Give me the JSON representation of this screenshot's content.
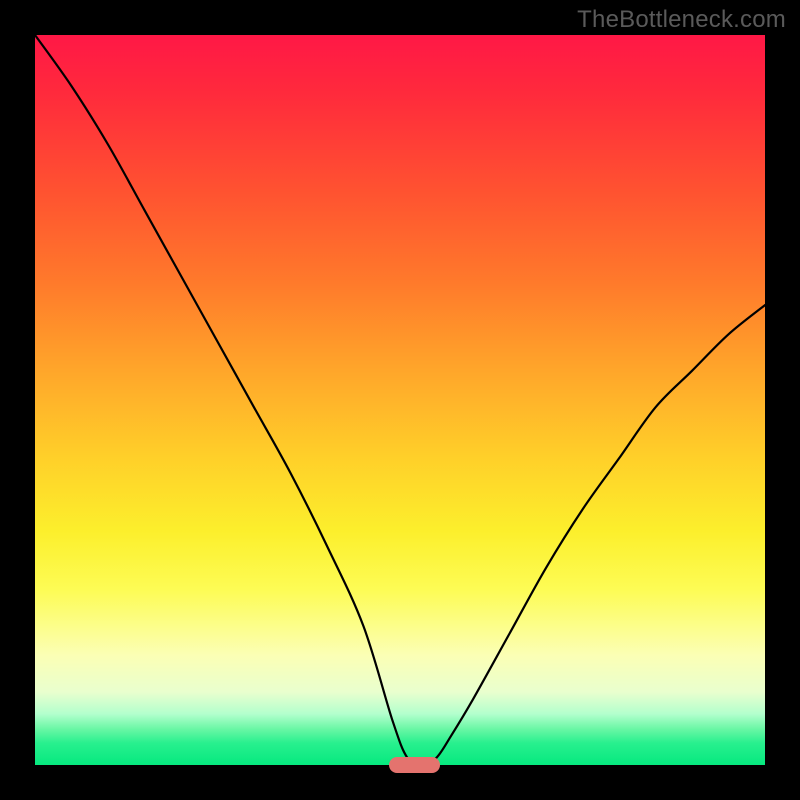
{
  "site_watermark": "TheBottleneck.com",
  "chart_data": {
    "type": "line",
    "title": "",
    "xlabel": "",
    "ylabel": "",
    "xlim": [
      0,
      100
    ],
    "ylim": [
      0,
      100
    ],
    "grid": false,
    "legend": false,
    "background_gradient": {
      "direction": "vertical",
      "stops": [
        {
          "pos": 0,
          "color": "#ff1846"
        },
        {
          "pos": 50,
          "color": "#ffb528"
        },
        {
          "pos": 80,
          "color": "#fdfd60"
        },
        {
          "pos": 100,
          "color": "#06e97f"
        }
      ]
    },
    "series": [
      {
        "name": "bottleneck-curve",
        "color": "#000000",
        "x": [
          0,
          5,
          10,
          15,
          20,
          25,
          30,
          35,
          40,
          45,
          49,
          51,
          53,
          55,
          57,
          60,
          65,
          70,
          75,
          80,
          85,
          90,
          95,
          100
        ],
        "y": [
          100,
          93,
          85,
          76,
          67,
          58,
          49,
          40,
          30,
          19,
          6,
          1,
          0,
          1,
          4,
          9,
          18,
          27,
          35,
          42,
          49,
          54,
          59,
          63
        ]
      }
    ],
    "marker": {
      "name": "optimal-range",
      "color": "#e4736e",
      "x_center": 52,
      "width_pct": 7,
      "y": 0
    }
  }
}
